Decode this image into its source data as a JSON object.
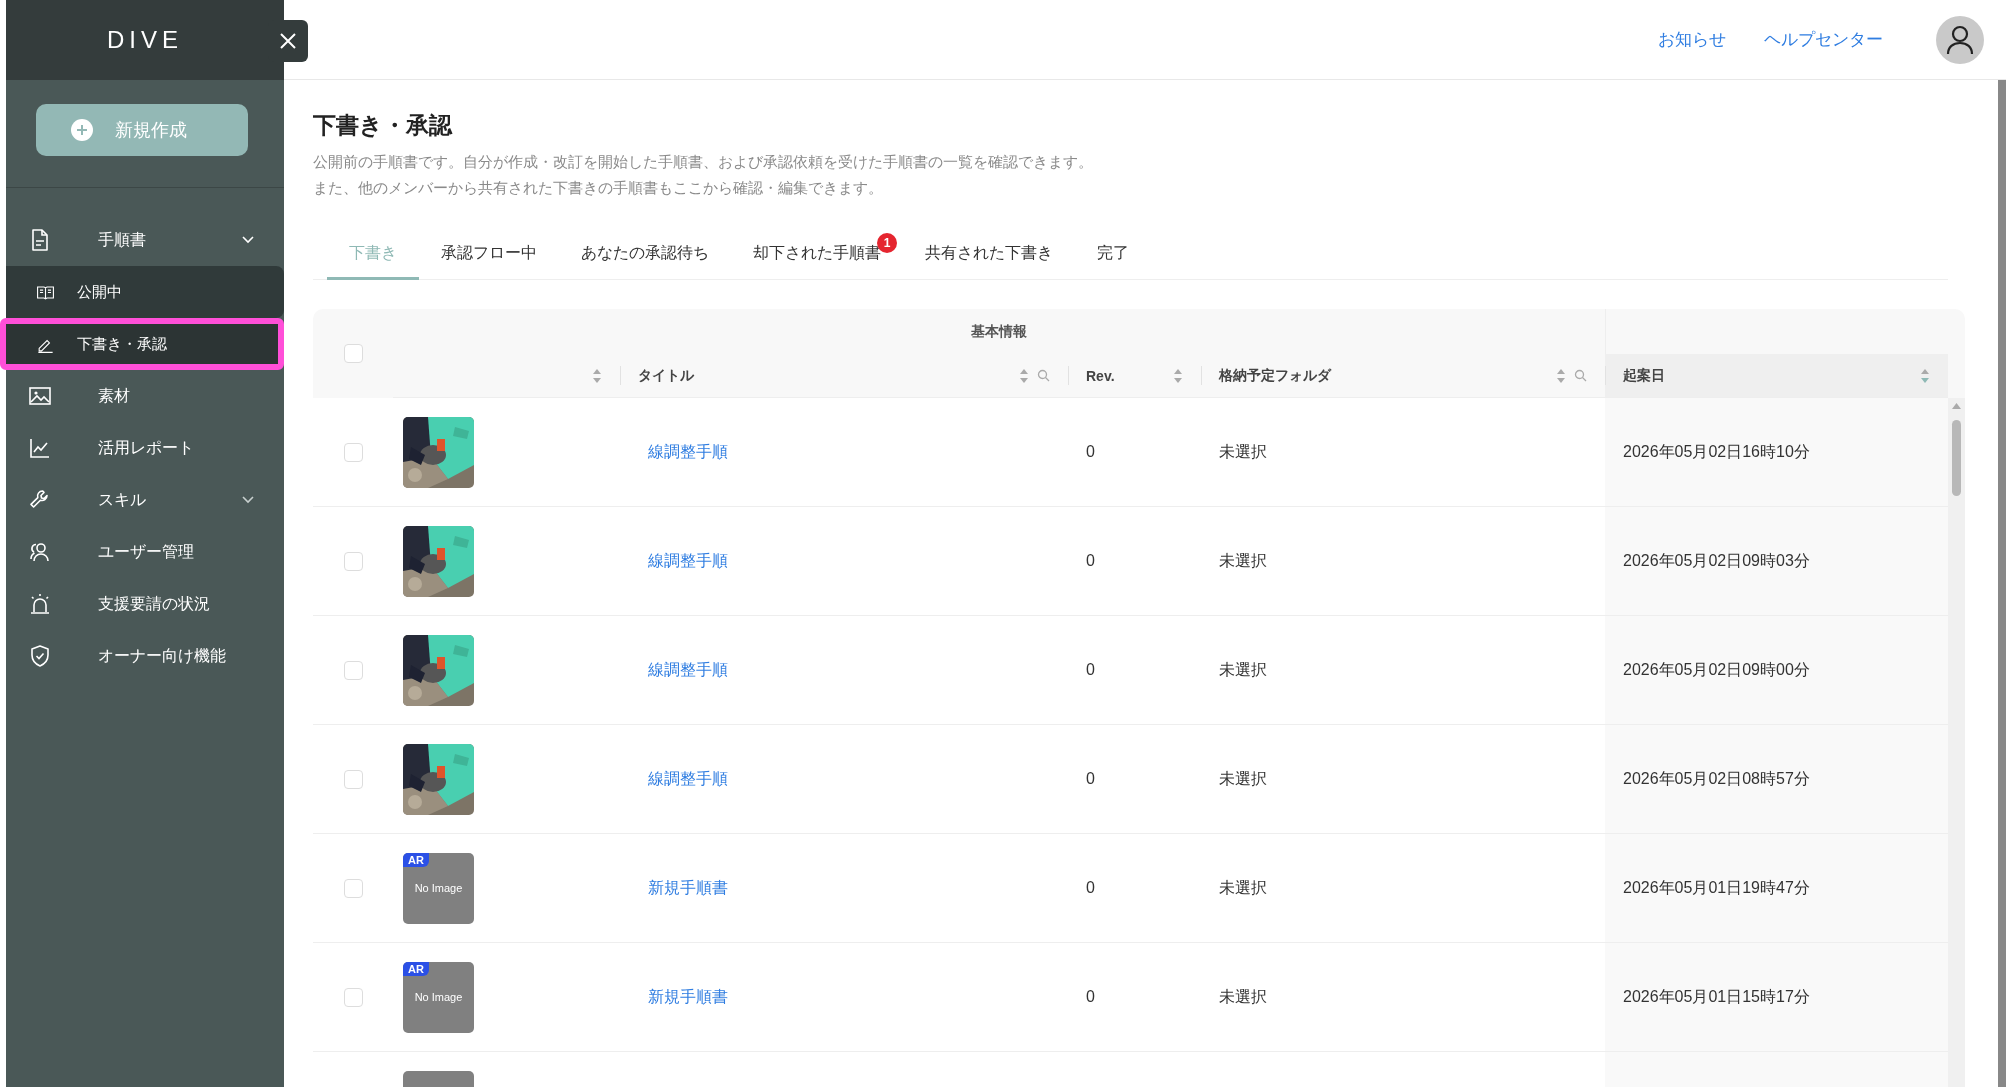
{
  "sidebar": {
    "logo": "DIVE",
    "new_button": "新規作成",
    "nav": [
      {
        "label": "手順書",
        "selected": false,
        "expanded": true,
        "children": [
          {
            "label": "公開中",
            "selected": false
          },
          {
            "label": "下書き・承認",
            "selected": true
          }
        ]
      },
      {
        "label": "素材",
        "selected": false
      },
      {
        "label": "活用レポート",
        "selected": false
      },
      {
        "label": "スキル",
        "selected": false,
        "expanded": false
      },
      {
        "label": "ユーザー管理",
        "selected": false
      },
      {
        "label": "支援要請の状況",
        "selected": false
      },
      {
        "label": "オーナー向け機能",
        "selected": false
      }
    ]
  },
  "header": {
    "links": [
      "お知らせ",
      "ヘルプセンター"
    ]
  },
  "page": {
    "title": "下書き・承認",
    "description": [
      "公開前の手順書です。自分が作成・改訂を開始した手順書、および承認依頼を受けた手順書の一覧を確認できます。",
      "また、他のメンバーから共有された下書きの手順書もここから確認・編集できます。"
    ]
  },
  "tabs": [
    {
      "label": "下書き",
      "selected": true
    },
    {
      "label": "承認フロー中",
      "selected": false
    },
    {
      "label": "あなたの承認待ち",
      "selected": false
    },
    {
      "label": "却下された手順書",
      "selected": false,
      "badge": "1"
    },
    {
      "label": "共有された下書き",
      "selected": false
    },
    {
      "label": "完了",
      "selected": false
    }
  ],
  "table": {
    "group_header": "基本情報",
    "all_checked": false,
    "columns": [
      {
        "kind": "thumbnail",
        "sorted": false,
        "searchable": false
      },
      {
        "label": "タイトル",
        "sorted": false,
        "searchable": true
      },
      {
        "label": "Rev.",
        "sorted": false,
        "searchable": false
      },
      {
        "label": "格納予定フォルダ",
        "sorted": false,
        "searchable": true
      },
      {
        "label": "起案日",
        "sorted": true,
        "searchable": false
      }
    ],
    "rows": [
      {
        "checked": false,
        "title": "線調整手順",
        "rev": "0",
        "folder": "未選択",
        "date": "2026年05月02日16時10分"
      },
      {
        "checked": false,
        "title": "線調整手順",
        "rev": "0",
        "folder": "未選択",
        "date": "2026年05月02日09時03分"
      },
      {
        "checked": false,
        "title": "線調整手順",
        "rev": "0",
        "folder": "未選択",
        "date": "2026年05月02日09時00分"
      },
      {
        "checked": false,
        "title": "線調整手順",
        "rev": "0",
        "folder": "未選択",
        "date": "2026年05月02日08時57分"
      },
      {
        "checked": false,
        "thumbnail": {
          "kind": "placeholder",
          "text": "No Image",
          "badge": "AR"
        },
        "title": "新規手順書",
        "rev": "0",
        "folder": "未選択",
        "date": "2026年05月01日19時47分"
      },
      {
        "checked": false,
        "thumbnail": {
          "kind": "placeholder",
          "text": "No Image",
          "badge": "AR"
        },
        "title": "新規手順書",
        "rev": "0",
        "folder": "未選択",
        "date": "2026年05月01日15時17分"
      },
      {
        "thumbnail": {
          "kind": "placeholder"
        }
      }
    ]
  }
}
